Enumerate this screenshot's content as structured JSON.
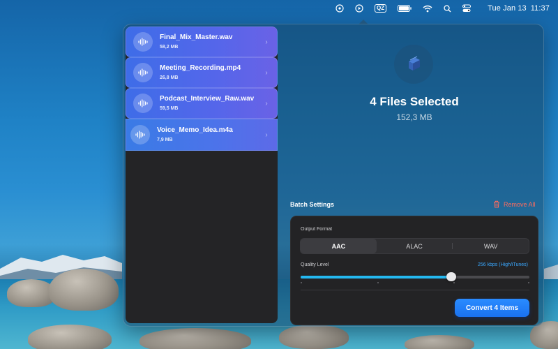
{
  "menubar": {
    "date": "Tue Jan 13",
    "time": "11:37",
    "qz_label": "QZ",
    "icons": [
      "app-status-icon",
      "play-circle-icon",
      "qz-icon",
      "battery-icon",
      "wifi-icon",
      "search-icon",
      "control-center-icon"
    ]
  },
  "files": [
    {
      "name": "Final_Mix_Master.wav",
      "size": "58,2 MB"
    },
    {
      "name": "Meeting_Recording.mp4",
      "size": "26,8 MB"
    },
    {
      "name": "Podcast_Interview_Raw.wav",
      "size": "59,5 MB"
    },
    {
      "name": "Voice_Memo_Idea.m4a",
      "size": "7,9 MB"
    }
  ],
  "selection": {
    "title": "4 Files Selected",
    "total_size": "152,3 MB"
  },
  "batch": {
    "label": "Batch Settings",
    "remove_all": "Remove All",
    "output_format_label": "Output Format",
    "formats": [
      "AAC",
      "ALAC",
      "WAV"
    ],
    "selected_format": "AAC",
    "quality_label": "Quality Level",
    "quality_value": "256 kbps (High/iTunes)",
    "quality_fraction": 0.66,
    "convert_label": "Convert 4 Items"
  },
  "colors": {
    "accent": "#1a7cf5",
    "remove": "#ff6b5e",
    "slider": "#24b8f0",
    "quality_text": "#3aa8ff"
  }
}
